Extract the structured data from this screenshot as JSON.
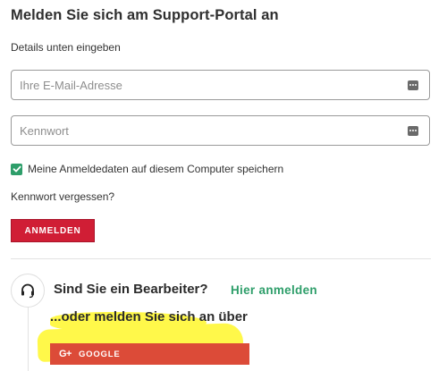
{
  "login": {
    "title": "Melden Sie sich am Support-Portal an",
    "subtitle": "Details unten eingeben",
    "email_placeholder": "Ihre E-Mail-Adresse",
    "email_value": "",
    "password_placeholder": "Kennwort",
    "password_value": "",
    "remember_label": "Meine Anmeldedaten auf diesem Computer speichern",
    "remember_checked": true,
    "forgot_label": "Kennwort vergessen?",
    "submit_label": "ANMELDEN"
  },
  "editor": {
    "question": "Sind Sie ein Bearbeiter?",
    "link_label": "Hier anmelden"
  },
  "social": {
    "or_label": "...oder melden Sie sich an über",
    "google_icon_text": "G+",
    "google_label": "GOOGLE"
  },
  "icons": {
    "field_icon": "dots-icon",
    "check": "checkmark-icon",
    "editor": "headset-icon"
  },
  "colors": {
    "accent_red": "#d01e35",
    "accent_green": "#2e9e6a",
    "google_red": "#dc4b38",
    "highlight_yellow": "#fff84a"
  }
}
